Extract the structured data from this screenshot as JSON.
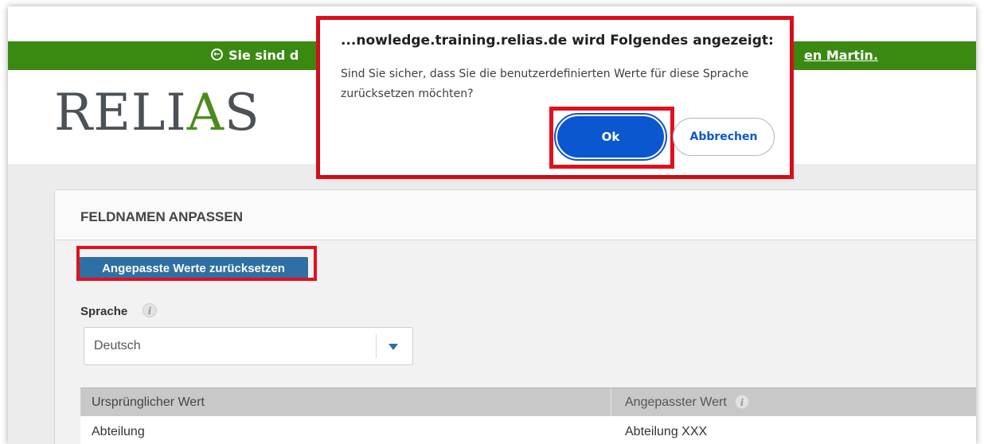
{
  "banner": {
    "text_left": "Sie sind d",
    "text_right": "en Martin.",
    "color": "#3a8a12"
  },
  "logo": {
    "before": "RELI",
    "mark": "A",
    "after": "S",
    "mark_color": "#4b8b1e"
  },
  "panel": {
    "title": "FELDNAMEN ANPASSEN",
    "reset_button_label": "Angepasste Werte zurücksetzen",
    "language_label": "Sprache",
    "language_value": "Deutsch"
  },
  "table": {
    "headers": [
      "Ursprünglicher Wert",
      "Angepasster Wert"
    ],
    "rows": [
      [
        "Abteilung",
        "Abteilung XXX"
      ]
    ]
  },
  "dialog": {
    "title": "...nowledge.training.relias.de wird Folgendes angezeigt:",
    "message": "Sind Sie sicher, dass Sie die benutzerdefinierten Werte für diese Sprache zurücksetzen möchten?",
    "ok_label": "Ok",
    "cancel_label": "Abbrechen",
    "accent_color": "#0b57d0"
  },
  "highlight_color": "#e3101c"
}
